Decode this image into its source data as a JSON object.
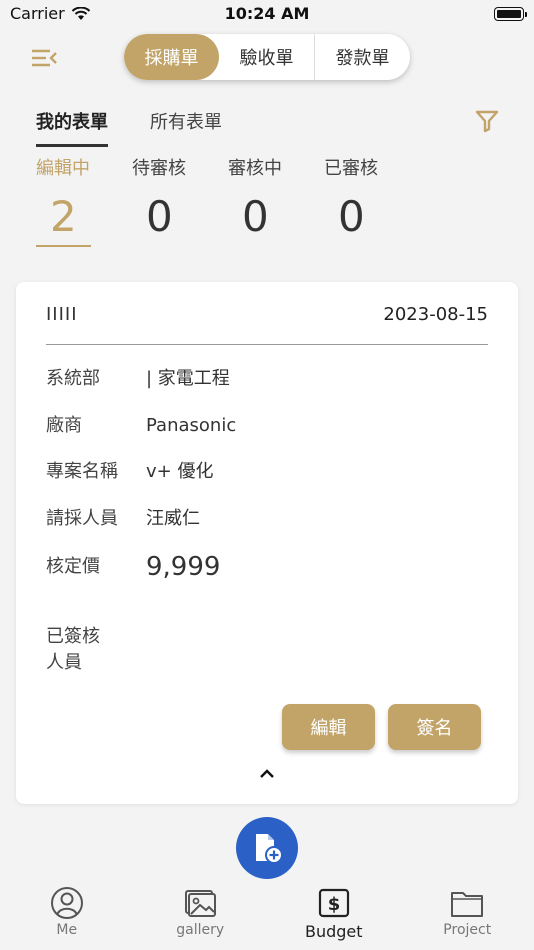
{
  "status_bar": {
    "carrier": "Carrier",
    "time": "10:24 AM"
  },
  "header": {
    "menu_icon": "menu-collapse-icon",
    "segments": [
      {
        "label": "採購單",
        "active": true
      },
      {
        "label": "驗收單",
        "active": false
      },
      {
        "label": "發款單",
        "active": false
      }
    ]
  },
  "subtabs": [
    {
      "label": "我的表單",
      "active": true
    },
    {
      "label": "所有表單",
      "active": false
    }
  ],
  "filter_icon": "filter-icon",
  "statuses": [
    {
      "label": "編輯中",
      "count": "2",
      "active": true
    },
    {
      "label": "待審核",
      "count": "0",
      "active": false
    },
    {
      "label": "審核中",
      "count": "0",
      "active": false
    },
    {
      "label": "已審核",
      "count": "0",
      "active": false
    }
  ],
  "card": {
    "code": "IIIII",
    "date": "2023-08-15",
    "fields": [
      {
        "label": "系統部",
        "value": "| 家電工程"
      },
      {
        "label": "廠商",
        "value": "Panasonic"
      },
      {
        "label": "專案名稱",
        "value": "v+ 優化"
      },
      {
        "label": "請採人員",
        "value": "汪威仁"
      },
      {
        "label": "核定價",
        "value": "9,999"
      }
    ],
    "signers_label": "已簽核人員",
    "edit_button": "編輯",
    "sign_button": "簽名"
  },
  "fab_icon": "add-document-icon",
  "bottom_nav": [
    {
      "label": "Me",
      "icon": "person-icon",
      "active": false
    },
    {
      "label": "gallery",
      "icon": "image-icon",
      "active": false
    },
    {
      "label": "Budget",
      "icon": "dollar-icon",
      "active": true
    },
    {
      "label": "Project",
      "icon": "folder-icon",
      "active": false
    }
  ],
  "colors": {
    "accent": "#c2a468",
    "fab": "#2b61c6",
    "background": "#f3f3f3"
  }
}
